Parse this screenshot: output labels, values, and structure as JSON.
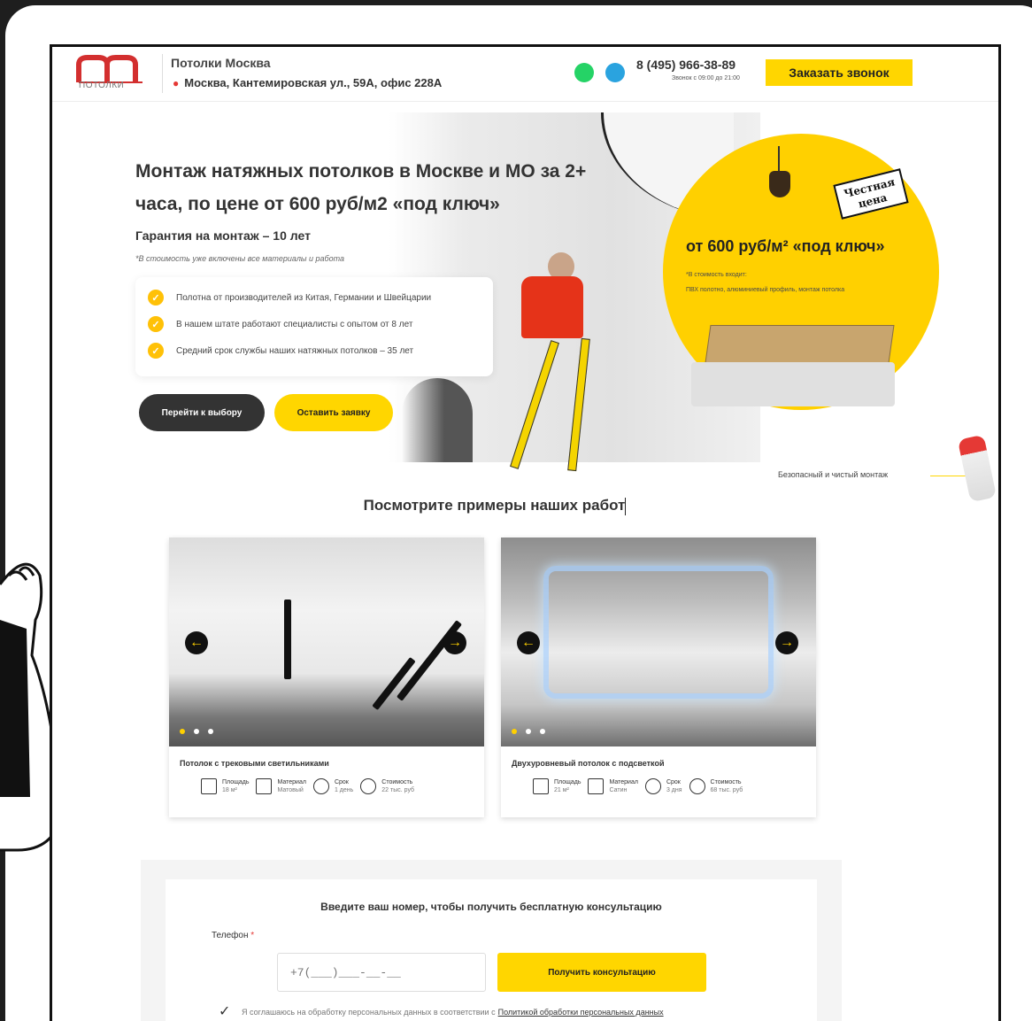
{
  "header": {
    "logo_sub": "ПОТОЛКИ",
    "company": "Потолки Москва",
    "address": "Москва, Кантемировская ул., 59А, офис 228А",
    "phone": "8 (495) 966-38-89",
    "hours": "Звонок с 09:00 до 21:00",
    "call_button": "Заказать звонок"
  },
  "hero": {
    "title": "Монтаж натяжных потолков в Москве и МО за 2+ часа, по цене от 600 руб/м2 «под ключ»",
    "guarantee": "Гарантия на монтаж – 10 лет",
    "note": "*В стоимость уже включены все материалы и работа",
    "features": [
      "Полотна от производителей из Китая, Германии и Швейцарии",
      "В нашем штате работают специалисты с опытом от 8 лет",
      "Средний срок службы наших натяжных потолков – 35 лет"
    ],
    "btn_choose": "Перейти к выбору",
    "btn_request": "Оставить заявку"
  },
  "price": {
    "stamp": "Честная цена",
    "title": "от 600 руб/м² «под ключ»",
    "included_label": "*В стоимость входит:",
    "included_items": "ПВХ полотно, алюминиевый профиль, монтаж потолка"
  },
  "safe_label": "Безопасный и чистый монтаж",
  "works": {
    "title": "Посмотрите примеры наших работ",
    "cards": [
      {
        "title": "Потолок с трековыми светильниками",
        "specs": [
          {
            "label": "Площадь",
            "value": "18 м²"
          },
          {
            "label": "Материал",
            "value": "Матовый"
          },
          {
            "label": "Срок",
            "value": "1 день"
          },
          {
            "label": "Стоимость",
            "value": "22 тыс. руб"
          }
        ]
      },
      {
        "title": "Двухуровневый потолок с подсветкой",
        "specs": [
          {
            "label": "Площадь",
            "value": "21 м²"
          },
          {
            "label": "Материал",
            "value": "Сатин"
          },
          {
            "label": "Срок",
            "value": "3 дня"
          },
          {
            "label": "Стоимость",
            "value": "68 тыс. руб"
          }
        ]
      }
    ]
  },
  "consult": {
    "title": "Введите ваш номер, чтобы получить бесплатную консультацию",
    "phone_label": "Телефон",
    "required_mark": "*",
    "phone_placeholder": "+7(___)___-__-__",
    "button": "Получить консультацию",
    "agree_text": "Я соглашаюсь на обработку персональных данных в соответствии с",
    "agree_link": "Политикой обработки персональных данных"
  },
  "icons": {
    "check": "✓",
    "arrow_left": "←",
    "arrow_right": "→",
    "pin": "📍"
  },
  "colors": {
    "accent": "#ffd600",
    "dark": "#333333",
    "brand_red": "#d32f2f"
  }
}
